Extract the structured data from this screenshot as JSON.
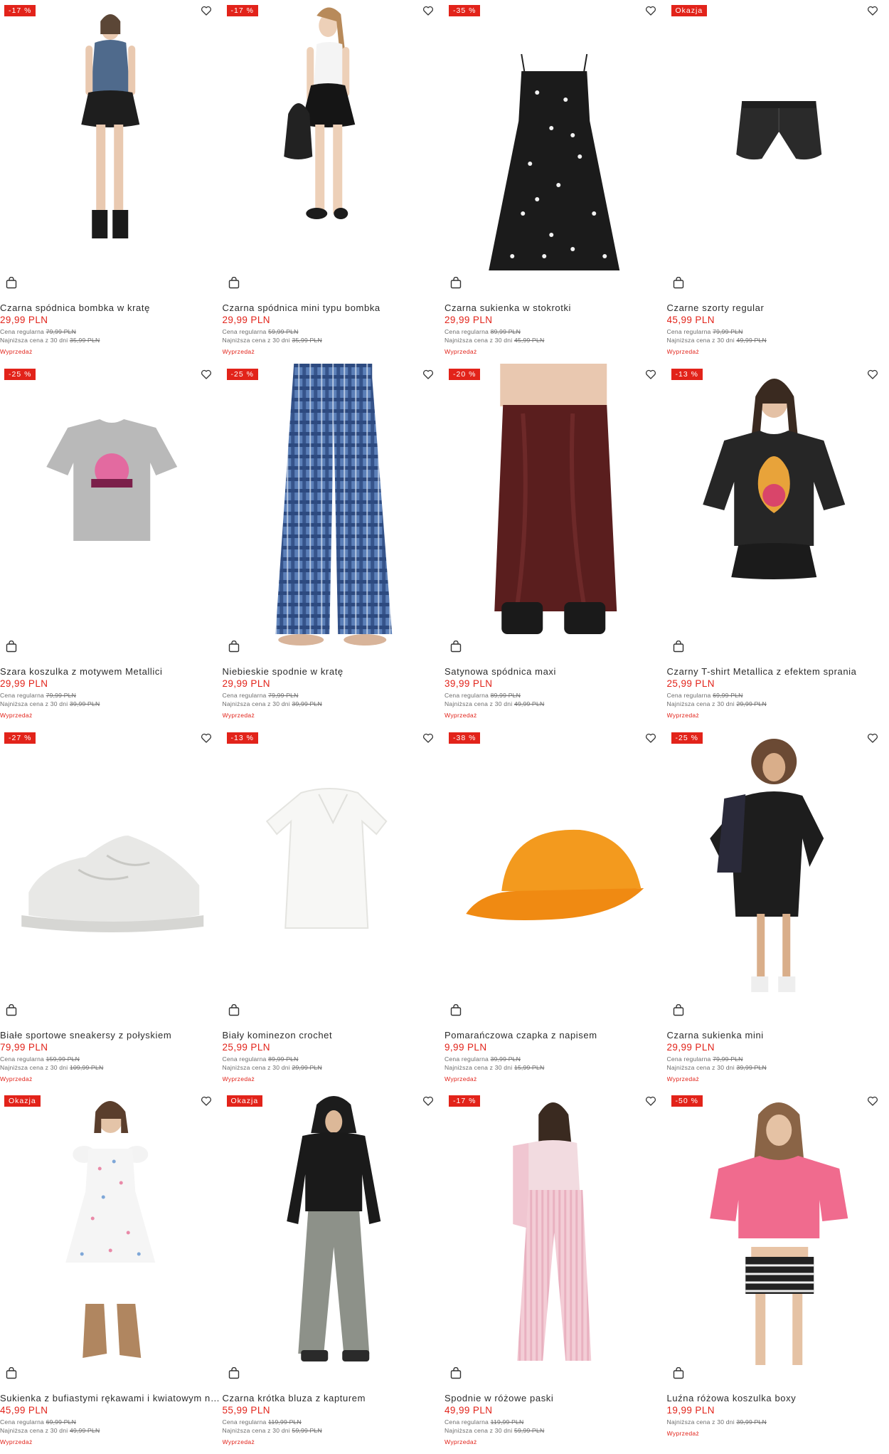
{
  "labels": {
    "regular": "Cena regularna",
    "lowest": "Najniższa cena z 30 dni",
    "sale": "Wyprzedaż"
  },
  "colors": {
    "accent": "#e2231a",
    "text": "#2b2b2b",
    "muted": "#6d6d6d"
  },
  "icons": {
    "favorite": "heart-icon",
    "cart": "shopping-bag-icon"
  },
  "products": [
    {
      "badge": "-17 %",
      "title": "Czarna spódnica bombka w kratę",
      "price": "29,99 PLN",
      "regular": "79,99 PLN",
      "lowest": "35,99 PLN",
      "tag": "Wyprzedaż"
    },
    {
      "badge": "-17 %",
      "title": "Czarna spódnica mini typu bombka",
      "price": "29,99 PLN",
      "regular": "59,99 PLN",
      "lowest": "35,99 PLN",
      "tag": "Wyprzedaż"
    },
    {
      "badge": "-35 %",
      "title": "Czarna sukienka w stokrotki",
      "price": "29,99 PLN",
      "regular": "89,99 PLN",
      "lowest": "45,99 PLN",
      "tag": "Wyprzedaż"
    },
    {
      "badge": "Okazja",
      "title": "Czarne szorty regular",
      "price": "45,99 PLN",
      "regular": "79,99 PLN",
      "lowest": "49,99 PLN",
      "tag": "Wyprzedaż"
    },
    {
      "badge": "-25 %",
      "title": "Szara koszulka z motywem Metallici",
      "price": "29,99 PLN",
      "regular": "79,99 PLN",
      "lowest": "39,99 PLN",
      "tag": "Wyprzedaż"
    },
    {
      "badge": "-25 %",
      "title": "Niebieskie spodnie w kratę",
      "price": "29,99 PLN",
      "regular": "79,99 PLN",
      "lowest": "39,99 PLN",
      "tag": "Wyprzedaż"
    },
    {
      "badge": "-20 %",
      "title": "Satynowa spódnica maxi",
      "price": "39,99 PLN",
      "regular": "89,99 PLN",
      "lowest": "49,99 PLN",
      "tag": "Wyprzedaż"
    },
    {
      "badge": "-13 %",
      "title": "Czarny T-shirt Metallica z efektem sprania",
      "price": "25,99 PLN",
      "regular": "69,99 PLN",
      "lowest": "29,99 PLN",
      "tag": "Wyprzedaż"
    },
    {
      "badge": "-27 %",
      "title": "Białe sportowe sneakersy z połyskiem",
      "price": "79,99 PLN",
      "regular": "159,99 PLN",
      "lowest": "109,99 PLN",
      "tag": "Wyprzedaż"
    },
    {
      "badge": "-13 %",
      "title": "Biały kominezon crochet",
      "price": "25,99 PLN",
      "regular": "89,99 PLN",
      "lowest": "29,99 PLN",
      "tag": "Wyprzedaż"
    },
    {
      "badge": "-38 %",
      "title": "Pomarańczowa czapka z napisem",
      "price": "9,99 PLN",
      "regular": "39,99 PLN",
      "lowest": "15,99 PLN",
      "tag": "Wyprzedaż"
    },
    {
      "badge": "-25 %",
      "title": "Czarna sukienka mini",
      "price": "29,99 PLN",
      "regular": "79,99 PLN",
      "lowest": "39,99 PLN",
      "tag": "Wyprzedaż"
    },
    {
      "badge": "Okazja",
      "title": "Sukienka z bufiastymi rękawami i kwiatowym n…",
      "price": "45,99 PLN",
      "regular": "69,99 PLN",
      "lowest": "49,99 PLN",
      "tag": "Wyprzedaż"
    },
    {
      "badge": "Okazja",
      "title": "Czarna krótka bluza z kapturem",
      "price": "55,99 PLN",
      "regular": "119,99 PLN",
      "lowest": "59,99 PLN",
      "tag": "Wyprzedaż"
    },
    {
      "badge": "-17 %",
      "title": "Spodnie w różowe paski",
      "price": "49,99 PLN",
      "regular": "119,99 PLN",
      "lowest": "59,99 PLN",
      "tag": "Wyprzedaż"
    },
    {
      "badge": "-50 %",
      "title": "Luźna różowa koszulka boxy",
      "price": "19,99 PLN",
      "lowest": "39,99 PLN",
      "tag": "Wyprzedaż"
    }
  ]
}
